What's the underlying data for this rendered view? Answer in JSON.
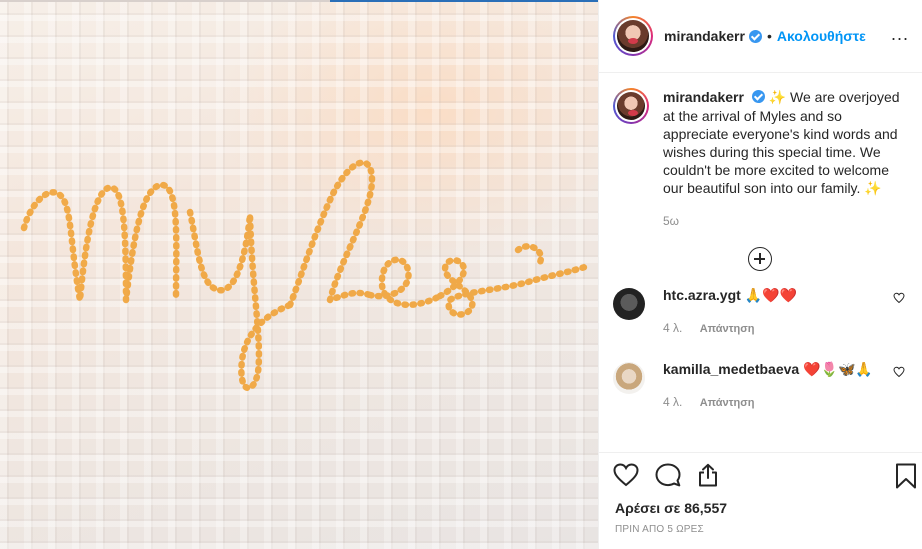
{
  "photo": {
    "stitched_text": "Myles"
  },
  "header": {
    "username": "mirandakerr",
    "separator": "•",
    "follow_label": "Ακολουθήστε",
    "more": "..."
  },
  "caption": {
    "username": "mirandakerr",
    "text_lines": [
      "We are overjoyed",
      "at the arrival of Myles and so",
      "appreciate everyone's kind words and",
      "wishes during this special time. We",
      "couldn't be more excited to welcome",
      "our beautiful son into our family."
    ],
    "sparkle": "✨",
    "time": "5ω"
  },
  "comments": [
    {
      "username": "htc.azra.ygt",
      "text": "🙏❤️❤️",
      "time": "4 λ.",
      "reply": "Απάντηση"
    },
    {
      "username": "kamilla_medetbaeva",
      "text": "❤️🌷🦋🙏",
      "time": "4 λ.",
      "reply": "Απάντηση"
    }
  ],
  "actions": {
    "likes_text": "Αρέσει σε 86,557",
    "posted_ago": "ΠΡΙΝ ΑΠΟ 5 ΩΡΕΣ"
  },
  "colors": {
    "link": "#0095f6",
    "stitch": "#f0a640",
    "verified": "#3897f0"
  }
}
